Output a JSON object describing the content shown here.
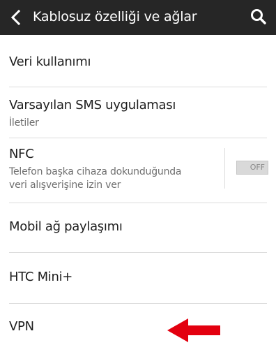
{
  "header": {
    "title": "Kablosuz özelliği ve ağlar",
    "back_icon": "back-chevron-icon",
    "search_icon": "search-icon"
  },
  "settings": {
    "items": [
      {
        "title": "Veri kullanımı"
      },
      {
        "title": "Varsayılan SMS uygulaması",
        "summary": "İletiler"
      },
      {
        "title": "NFC",
        "summary_line1": "Telefon başka cihaza dokunduğunda",
        "summary_line2": "veri alışverişine izin ver",
        "toggle_label": "OFF"
      },
      {
        "title": "Mobil ağ paylaşımı"
      },
      {
        "title": "HTC Mini+"
      },
      {
        "title": "VPN"
      }
    ]
  },
  "colors": {
    "app_bar": "#262626",
    "arrow": "#e3000f",
    "divider": "#dcdcdc"
  },
  "annotation": {
    "icon": "red-arrow-icon"
  }
}
